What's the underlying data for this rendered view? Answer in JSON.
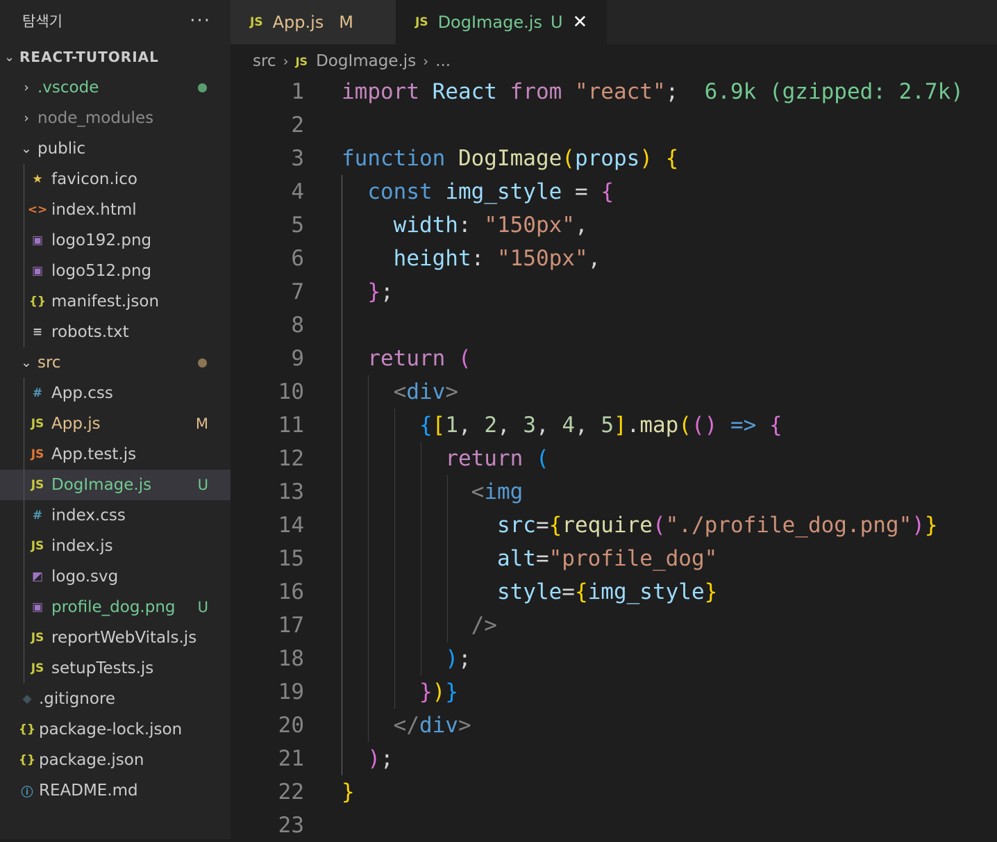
{
  "sidebar": {
    "title": "탐색기",
    "more": "···",
    "root": "REACT-TUTORIAL",
    "items": [
      {
        "label": ".vscode",
        "icon": "›",
        "kind": "folder-collapsed",
        "color": "#73c991",
        "dot": "#5a9e6f"
      },
      {
        "label": "node_modules",
        "icon": "›",
        "kind": "folder-collapsed",
        "color": "#8c8c8c"
      },
      {
        "label": "public",
        "icon": "⌄",
        "kind": "folder-open",
        "color": "#cccccc"
      },
      {
        "label": "favicon.ico",
        "icon": "★",
        "kind": "star-icon",
        "color": "#cccccc",
        "icolor": "#e8c34b"
      },
      {
        "label": "index.html",
        "icon": "<>",
        "kind": "html-icon",
        "color": "#cccccc",
        "icolor": "#e37933"
      },
      {
        "label": "logo192.png",
        "icon": "▣",
        "kind": "image-icon",
        "color": "#cccccc",
        "icolor": "#a074c4"
      },
      {
        "label": "logo512.png",
        "icon": "▣",
        "kind": "image-icon",
        "color": "#cccccc",
        "icolor": "#a074c4"
      },
      {
        "label": "manifest.json",
        "icon": "{}",
        "kind": "json-icon",
        "color": "#cccccc",
        "icolor": "#cbcb41"
      },
      {
        "label": "robots.txt",
        "icon": "≡",
        "kind": "text-icon",
        "color": "#cccccc",
        "icolor": "#cccccc"
      },
      {
        "label": "src",
        "icon": "⌄",
        "kind": "folder-open",
        "color": "#e2c08d",
        "dot": "#8a7454"
      },
      {
        "label": "App.css",
        "icon": "#",
        "kind": "css-icon",
        "color": "#cccccc",
        "icolor": "#519aba"
      },
      {
        "label": "App.js",
        "icon": "JS",
        "kind": "js-icon",
        "color": "#e2c08d",
        "icolor": "#cbcb41",
        "badge": "M"
      },
      {
        "label": "App.test.js",
        "icon": "JS",
        "kind": "js-icon",
        "color": "#cccccc",
        "icolor": "#e37933"
      },
      {
        "label": "DogImage.js",
        "icon": "JS",
        "kind": "js-icon",
        "color": "#73c991",
        "icolor": "#cbcb41",
        "badge": "U",
        "selected": true
      },
      {
        "label": "index.css",
        "icon": "#",
        "kind": "css-icon",
        "color": "#cccccc",
        "icolor": "#519aba"
      },
      {
        "label": "index.js",
        "icon": "JS",
        "kind": "js-icon",
        "color": "#cccccc",
        "icolor": "#cbcb41"
      },
      {
        "label": "logo.svg",
        "icon": "◩",
        "kind": "svg-icon",
        "color": "#cccccc",
        "icolor": "#a074c4"
      },
      {
        "label": "profile_dog.png",
        "icon": "▣",
        "kind": "image-icon",
        "color": "#73c991",
        "icolor": "#a074c4",
        "badge": "U"
      },
      {
        "label": "reportWebVitals.js",
        "icon": "JS",
        "kind": "js-icon",
        "color": "#cccccc",
        "icolor": "#cbcb41"
      },
      {
        "label": "setupTests.js",
        "icon": "JS",
        "kind": "js-icon",
        "color": "#cccccc",
        "icolor": "#cbcb41"
      },
      {
        "label": ".gitignore",
        "icon": "◆",
        "kind": "git-icon",
        "color": "#cccccc",
        "icolor": "#41535b"
      },
      {
        "label": "package-lock.json",
        "icon": "{}",
        "kind": "json-icon",
        "color": "#cccccc",
        "icolor": "#cbcb41"
      },
      {
        "label": "package.json",
        "icon": "{}",
        "kind": "json-icon",
        "color": "#cccccc",
        "icolor": "#cbcb41"
      },
      {
        "label": "README.md",
        "icon": "ⓘ",
        "kind": "info-icon",
        "color": "#cccccc",
        "icolor": "#519aba"
      }
    ]
  },
  "tabs": [
    {
      "icon": "JS",
      "label": "App.js",
      "status": "M",
      "active": false
    },
    {
      "icon": "JS",
      "label": "DogImage.js",
      "status": "U",
      "close": "✕",
      "active": true
    }
  ],
  "breadcrumb": {
    "folder": "src",
    "sep": "›",
    "icon": "JS",
    "file": "DogImage.js",
    "more": "..."
  },
  "code": [
    {
      "n": "1",
      "t": [
        [
          "kw",
          "import"
        ],
        [
          "plain",
          " "
        ],
        [
          "var",
          "React"
        ],
        [
          "plain",
          " "
        ],
        [
          "kw",
          "from"
        ],
        [
          "plain",
          " "
        ],
        [
          "str",
          "\"react\""
        ],
        [
          "plain",
          ";  "
        ],
        [
          "hint",
          "6.9k (gzipped: 2.7k)"
        ]
      ]
    },
    {
      "n": "2",
      "t": []
    },
    {
      "n": "3",
      "t": [
        [
          "kb",
          "function"
        ],
        [
          "plain",
          " "
        ],
        [
          "fn",
          "DogImage"
        ],
        [
          "b1",
          "("
        ],
        [
          "var",
          "props"
        ],
        [
          "b1",
          ")"
        ],
        [
          "plain",
          " "
        ],
        [
          "b1",
          "{"
        ]
      ]
    },
    {
      "n": "4",
      "t": [
        [
          "plain",
          "  "
        ],
        [
          "kb",
          "const"
        ],
        [
          "plain",
          " "
        ],
        [
          "var",
          "img_style"
        ],
        [
          "plain",
          " = "
        ],
        [
          "b2",
          "{"
        ]
      ]
    },
    {
      "n": "5",
      "t": [
        [
          "plain",
          "    "
        ],
        [
          "var",
          "width"
        ],
        [
          "plain",
          ": "
        ],
        [
          "str",
          "\"150px\""
        ],
        [
          "plain",
          ","
        ]
      ]
    },
    {
      "n": "6",
      "t": [
        [
          "plain",
          "    "
        ],
        [
          "var",
          "height"
        ],
        [
          "plain",
          ": "
        ],
        [
          "str",
          "\"150px\""
        ],
        [
          "plain",
          ","
        ]
      ]
    },
    {
      "n": "7",
      "t": [
        [
          "plain",
          "  "
        ],
        [
          "b2",
          "}"
        ],
        [
          "plain",
          ";"
        ]
      ]
    },
    {
      "n": "8",
      "t": []
    },
    {
      "n": "9",
      "t": [
        [
          "plain",
          "  "
        ],
        [
          "kw",
          "return"
        ],
        [
          "plain",
          " "
        ],
        [
          "b2",
          "("
        ]
      ]
    },
    {
      "n": "10",
      "t": [
        [
          "plain",
          "    "
        ],
        [
          "pun",
          "<"
        ],
        [
          "tag",
          "div"
        ],
        [
          "pun",
          ">"
        ]
      ]
    },
    {
      "n": "11",
      "t": [
        [
          "plain",
          "      "
        ],
        [
          "b3",
          "{"
        ],
        [
          "b1",
          "["
        ],
        [
          "num",
          "1"
        ],
        [
          "plain",
          ", "
        ],
        [
          "num",
          "2"
        ],
        [
          "plain",
          ", "
        ],
        [
          "num",
          "3"
        ],
        [
          "plain",
          ", "
        ],
        [
          "num",
          "4"
        ],
        [
          "plain",
          ", "
        ],
        [
          "num",
          "5"
        ],
        [
          "b1",
          "]"
        ],
        [
          "plain",
          "."
        ],
        [
          "fn",
          "map"
        ],
        [
          "b1",
          "("
        ],
        [
          "b2",
          "()"
        ],
        [
          "plain",
          " "
        ],
        [
          "kb",
          "=>"
        ],
        [
          "plain",
          " "
        ],
        [
          "b2",
          "{"
        ]
      ]
    },
    {
      "n": "12",
      "t": [
        [
          "plain",
          "        "
        ],
        [
          "kw",
          "return"
        ],
        [
          "plain",
          " "
        ],
        [
          "b3",
          "("
        ]
      ]
    },
    {
      "n": "13",
      "t": [
        [
          "plain",
          "          "
        ],
        [
          "pun",
          "<"
        ],
        [
          "tag",
          "img"
        ]
      ]
    },
    {
      "n": "14",
      "t": [
        [
          "plain",
          "            "
        ],
        [
          "var",
          "src"
        ],
        [
          "plain",
          "="
        ],
        [
          "b1",
          "{"
        ],
        [
          "fn",
          "require"
        ],
        [
          "b2",
          "("
        ],
        [
          "str",
          "\"./profile_dog.png\""
        ],
        [
          "b2",
          ")"
        ],
        [
          "b1",
          "}"
        ]
      ]
    },
    {
      "n": "15",
      "t": [
        [
          "plain",
          "            "
        ],
        [
          "var",
          "alt"
        ],
        [
          "plain",
          "="
        ],
        [
          "str",
          "\"profile_dog\""
        ]
      ]
    },
    {
      "n": "16",
      "t": [
        [
          "plain",
          "            "
        ],
        [
          "var",
          "style"
        ],
        [
          "plain",
          "="
        ],
        [
          "b1",
          "{"
        ],
        [
          "var",
          "img_style"
        ],
        [
          "b1",
          "}"
        ]
      ]
    },
    {
      "n": "17",
      "t": [
        [
          "plain",
          "          "
        ],
        [
          "pun",
          "/>"
        ]
      ]
    },
    {
      "n": "18",
      "t": [
        [
          "plain",
          "        "
        ],
        [
          "b3",
          ")"
        ],
        [
          "plain",
          ";"
        ]
      ]
    },
    {
      "n": "19",
      "t": [
        [
          "plain",
          "      "
        ],
        [
          "b2",
          "}"
        ],
        [
          "b1",
          ")"
        ],
        [
          "b3",
          "}"
        ]
      ]
    },
    {
      "n": "20",
      "t": [
        [
          "plain",
          "    "
        ],
        [
          "pun",
          "</"
        ],
        [
          "tag",
          "div"
        ],
        [
          "pun",
          ">"
        ]
      ]
    },
    {
      "n": "21",
      "t": [
        [
          "plain",
          "  "
        ],
        [
          "b2",
          ")"
        ],
        [
          "plain",
          ";"
        ]
      ]
    },
    {
      "n": "22",
      "t": [
        [
          "b1",
          "}"
        ]
      ]
    },
    {
      "n": "23",
      "t": []
    }
  ]
}
